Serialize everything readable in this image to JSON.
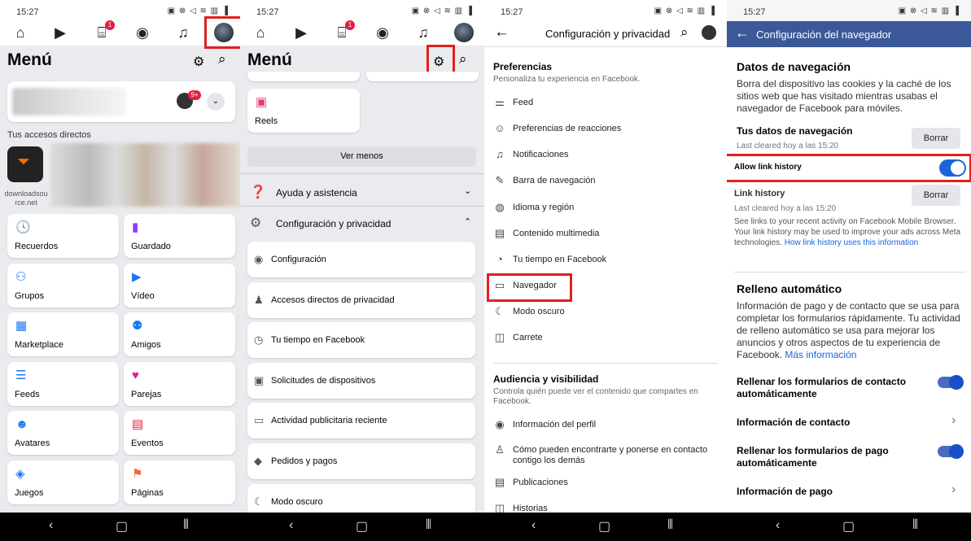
{
  "panels": [
    {
      "time": "15:27"
    },
    {
      "time": "15:27"
    },
    {
      "time": "15:27"
    },
    {
      "time": "15:27"
    }
  ],
  "status_icons": "▣ ⊗ ◁ ≋ ▥ ▐",
  "p1": {
    "title": "Menú",
    "badge_notif": "1",
    "profile_badge": "9+",
    "shortcuts_label": "Tus accesos directos",
    "shortcut_name": "downloadsource.net",
    "tiles": [
      {
        "label": "Recuerdos",
        "icon": "clock-icon"
      },
      {
        "label": "Guardado",
        "icon": "bookmark-icon"
      },
      {
        "label": "Grupos",
        "icon": "groups-icon"
      },
      {
        "label": "Vídeo",
        "icon": "video-icon"
      },
      {
        "label": "Marketplace",
        "icon": "shop-icon"
      },
      {
        "label": "Amigos",
        "icon": "friends-icon"
      },
      {
        "label": "Feeds",
        "icon": "feeds-icon"
      },
      {
        "label": "Parejas",
        "icon": "heart-icon"
      },
      {
        "label": "Avatares",
        "icon": "avatar-icon"
      },
      {
        "label": "Eventos",
        "icon": "calendar-icon"
      },
      {
        "label": "Juegos",
        "icon": "gamepad-icon"
      },
      {
        "label": "Páginas",
        "icon": "flag-icon"
      }
    ]
  },
  "p2": {
    "title": "Menú",
    "badge_notif": "1",
    "reels": "Reels",
    "ver_menos": "Ver menos",
    "ayuda": "Ayuda y asistencia",
    "config": "Configuración y privacidad",
    "rows": [
      "Configuración",
      "Accesos directos de privacidad",
      "Tu tiempo en Facebook",
      "Solicitudes de dispositivos",
      "Actividad publicitaria reciente",
      "Pedidos y pagos",
      "Modo oscuro"
    ]
  },
  "p3": {
    "title": "Configuración y privacidad",
    "pref_title": "Preferencias",
    "pref_sub": "Personaliza tu experiencia en Facebook.",
    "pref_rows": [
      "Feed",
      "Preferencias de reacciones",
      "Notificaciones",
      "Barra de navegación",
      "Idioma y región",
      "Contenido multimedia",
      "Tu tiempo en Facebook",
      "Navegador",
      "Modo oscuro",
      "Carrete"
    ],
    "aud_title": "Audiencia y visibilidad",
    "aud_sub": "Controla quién puede ver el contenido que compartes en Facebook.",
    "aud_rows": [
      "Información del perfil",
      "Cómo pueden encontrarte y ponerse en contacto contigo los demás",
      "Publicaciones",
      "Historias"
    ]
  },
  "p4": {
    "header": "Configuración del navegador",
    "nav_title": "Datos de navegación",
    "nav_desc": "Borra del dispositivo las cookies y la caché de los sitios web que has visitado mientras usabas el navegador de Facebook para móviles.",
    "tus_datos": "Tus datos de navegación",
    "last_cleared_1": "Last cleared hoy a las 15:20",
    "borrar": "Borrar",
    "allow_link": "Allow link history",
    "link_history": "Link history",
    "last_cleared_2": "Last cleared hoy a las 15:20",
    "link_desc": "See links to your recent activity on Facebook Mobile Browser. Your link history may be used to improve your ads across Meta technologies.",
    "link_more": "How link history uses this information",
    "relleno_title": "Relleno automático",
    "relleno_desc": "Información de pago y de contacto que se usa para completar los formularios rápidamente. Tu actividad de relleno automático se usa para mejorar los anuncios y otros aspectos de tu experiencia de Facebook.",
    "mas_info": "Más información",
    "rellenar_contacto": "Rellenar los formularios de contacto automáticamente",
    "info_contacto": "Información de contacto",
    "rellenar_pago": "Rellenar los formularios de pago automáticamente",
    "info_pago": "Información de pago"
  },
  "colors": {
    "fb_blue": "#3b5998",
    "highlight": "#e02020",
    "toggle": "#1a4fc9"
  }
}
